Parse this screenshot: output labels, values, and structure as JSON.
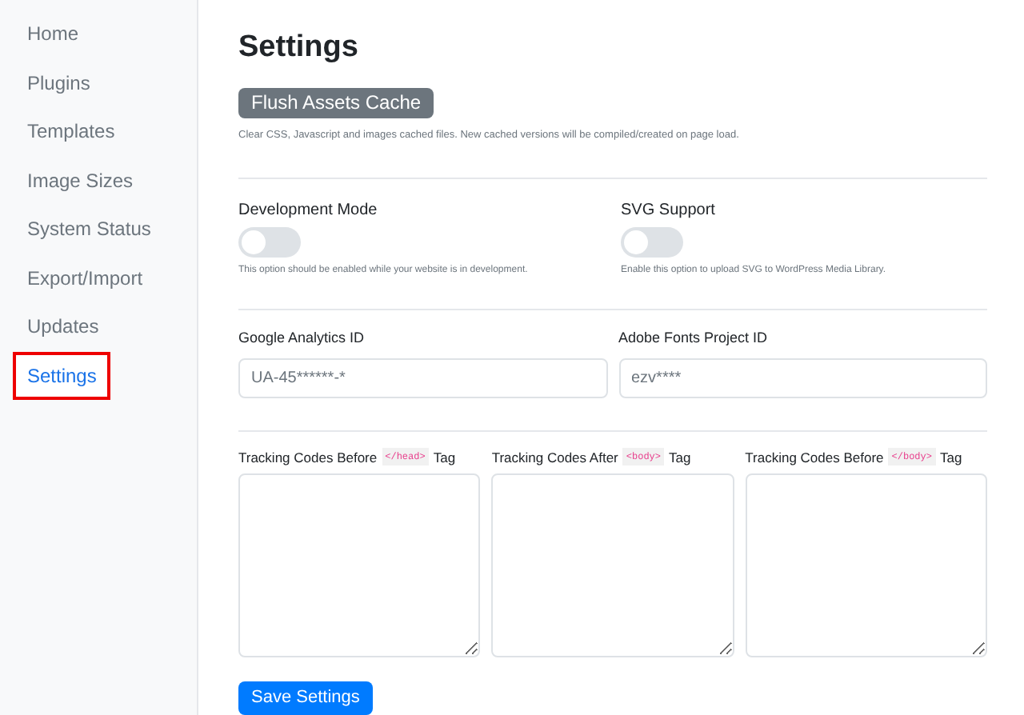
{
  "sidebar": {
    "items": [
      {
        "label": "Home",
        "selected": false
      },
      {
        "label": "Plugins",
        "selected": false
      },
      {
        "label": "Templates",
        "selected": false
      },
      {
        "label": "Image Sizes",
        "selected": false
      },
      {
        "label": "System Status",
        "selected": false
      },
      {
        "label": "Export/Import",
        "selected": false
      },
      {
        "label": "Updates",
        "selected": false
      },
      {
        "label": "Settings",
        "selected": true
      }
    ]
  },
  "title": "Settings",
  "flush": {
    "button": "Flush Assets Cache",
    "help": "Clear CSS, Javascript and images cached files. New cached versions will be compiled/created on page load."
  },
  "toggles": [
    {
      "label": "Development Mode",
      "on": false,
      "help": "This option should be enabled while your website is in development."
    },
    {
      "label": "SVG Support",
      "on": false,
      "help": "Enable this option to upload SVG to WordPress Media Library."
    }
  ],
  "fields": [
    {
      "label": "Google Analytics ID",
      "value": "UA-45******-*"
    },
    {
      "label": "Adobe Fonts Project ID",
      "value": "ezv****"
    }
  ],
  "tracking": [
    {
      "before": "Tracking Codes Before",
      "code": "</head>",
      "after": "Tag"
    },
    {
      "before": "Tracking Codes After",
      "code": "<body>",
      "after": "Tag"
    },
    {
      "before": "Tracking Codes Before",
      "code": "</body>",
      "after": "Tag"
    }
  ],
  "save_button": "Save Settings"
}
